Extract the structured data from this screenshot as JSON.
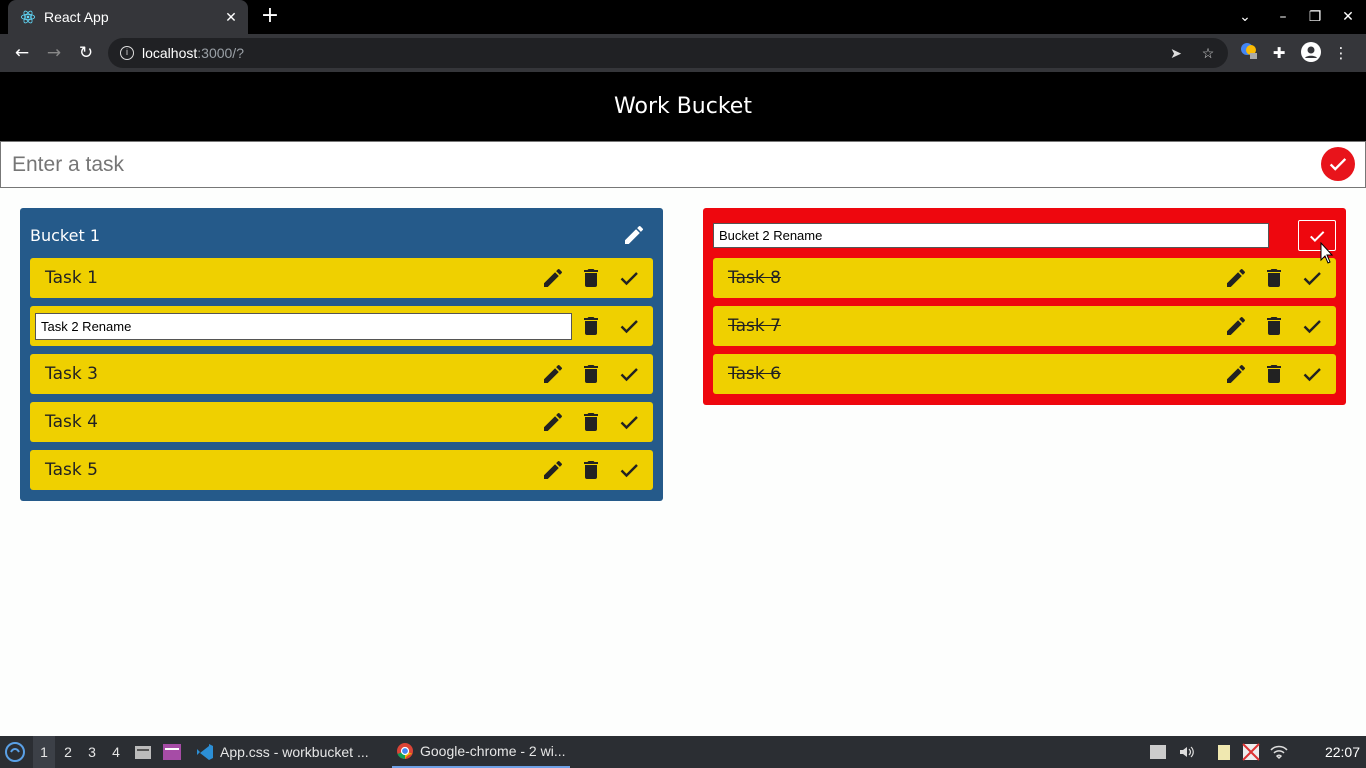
{
  "browser": {
    "tab_title": "React App",
    "tab_close": "✕",
    "new_tab": "+",
    "url_host": "localhost",
    "url_path": ":3000/?",
    "window_controls": [
      "chevron-down",
      "minimize",
      "restore",
      "close"
    ]
  },
  "app": {
    "title": "Work Bucket",
    "task_input_placeholder": "Enter a task",
    "task_input_value": ""
  },
  "buckets": [
    {
      "title": "Bucket 1",
      "mode": "view",
      "color": "#255a8a",
      "tasks": [
        {
          "label": "Task 1",
          "done": false,
          "editing": false
        },
        {
          "label": "Task 2 Rename",
          "done": false,
          "editing": true
        },
        {
          "label": "Task 3",
          "done": false,
          "editing": false
        },
        {
          "label": "Task 4",
          "done": false,
          "editing": false
        },
        {
          "label": "Task 5",
          "done": false,
          "editing": false
        }
      ]
    },
    {
      "title": "Bucket 2 Rename",
      "mode": "editing",
      "color": "#ee070e",
      "tasks": [
        {
          "label": "Task 8",
          "done": true,
          "editing": false
        },
        {
          "label": "Task 7",
          "done": true,
          "editing": false
        },
        {
          "label": "Task 6",
          "done": true,
          "editing": false
        }
      ]
    }
  ],
  "taskbar": {
    "workspaces": [
      "1",
      "2",
      "3",
      "4"
    ],
    "active_workspace": "1",
    "apps": [
      {
        "label": "App.css - workbucket ...",
        "icon": "vscode-icon",
        "active": false
      },
      {
        "label": "Google-chrome - 2 wi...",
        "icon": "chrome-icon",
        "active": true
      }
    ],
    "clock": "22:07"
  },
  "colors": {
    "header_bg": "#000000",
    "submit_red": "#e8141b",
    "task_yellow": "#efd000"
  }
}
